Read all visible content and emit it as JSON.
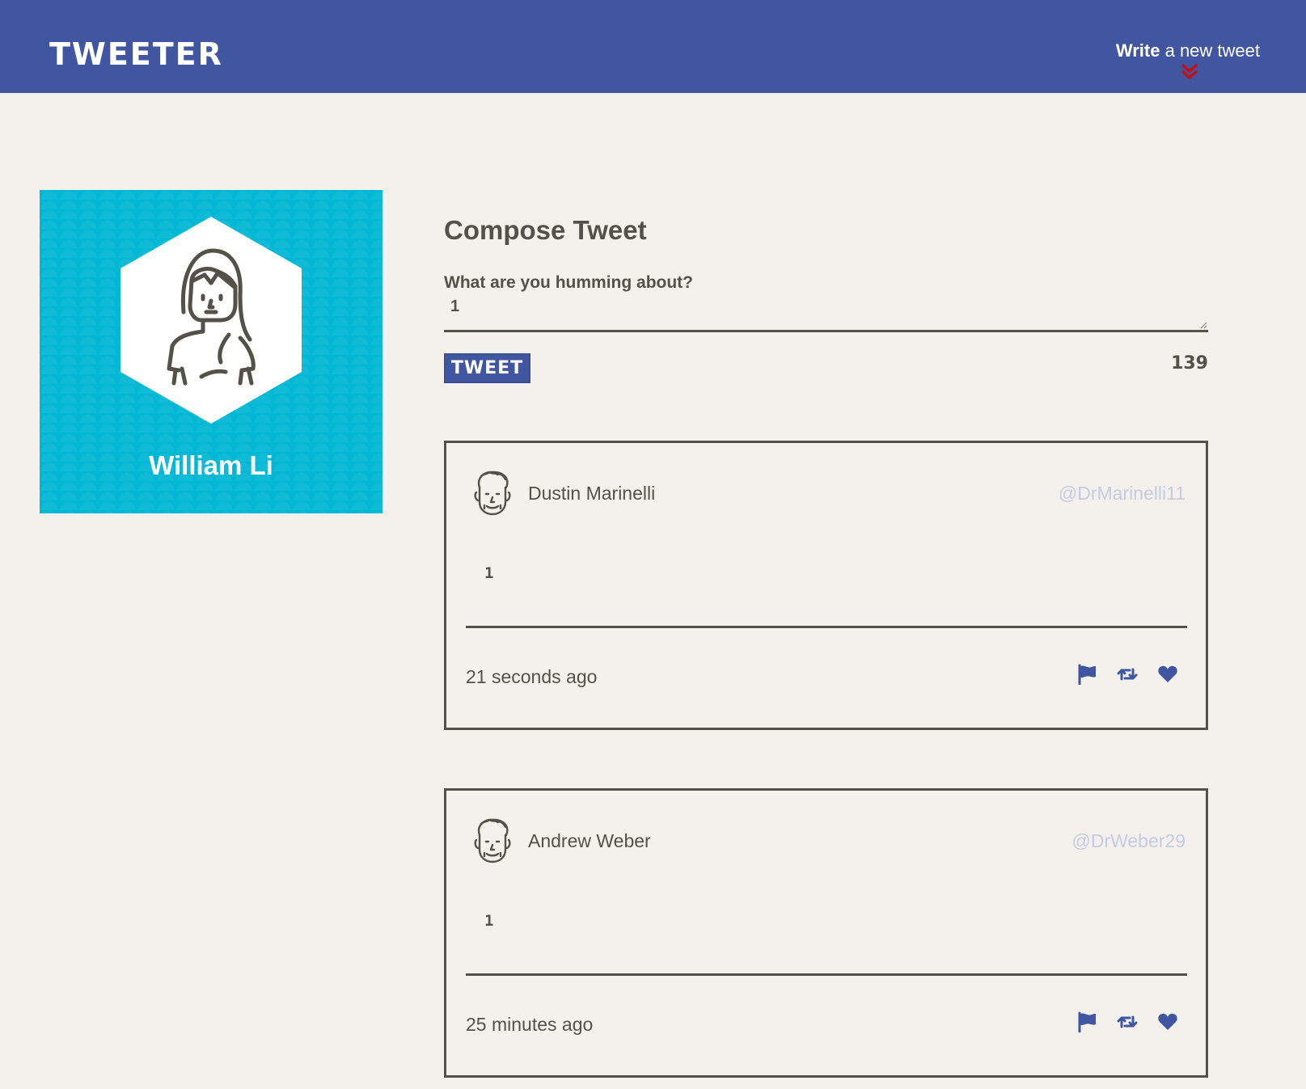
{
  "nav": {
    "logo": "TWEETER",
    "compose_bold": "Write",
    "compose_rest": " a new tweet",
    "chevron_color": "#c0101a"
  },
  "profile": {
    "name": "William Li",
    "background_color": "#00b7d4"
  },
  "compose": {
    "title": "Compose Tweet",
    "label": "What are you humming about?",
    "value": "1",
    "button_label": "TWEET",
    "counter": "139"
  },
  "tweets": [
    {
      "author": "Dustin Marinelli",
      "handle": "@DrMarinelli11",
      "content": "1",
      "time": "21 seconds ago",
      "actions": [
        "flag-icon",
        "retweet-icon",
        "heart-icon"
      ]
    },
    {
      "author": "Andrew Weber",
      "handle": "@DrWeber29",
      "content": "1",
      "time": "25 minutes ago",
      "actions": [
        "flag-icon",
        "retweet-icon",
        "heart-icon"
      ]
    }
  ],
  "colors": {
    "nav": "#4056a1",
    "page": "#f4f1ec",
    "text": "#545149",
    "handle": "#c5cbe3"
  }
}
